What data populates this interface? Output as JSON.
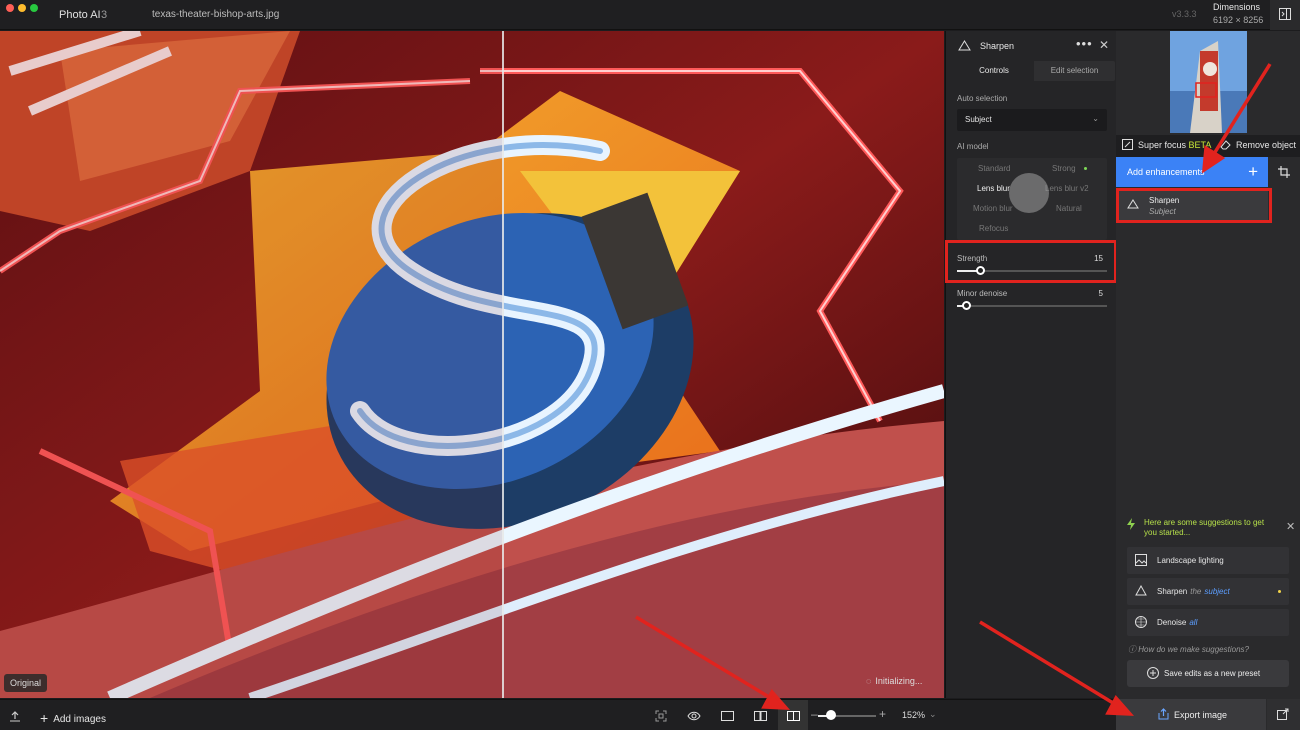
{
  "titlebar": {
    "app_name": "Photo AI",
    "app_version": "3",
    "file_name": "texas-theater-bishop-arts.jpg",
    "build": "v3.3.3",
    "dimensions_label": "Dimensions",
    "dimensions_value": "6192 × 8256"
  },
  "canvas": {
    "original_label": "Original",
    "status": "Initializing..."
  },
  "bottombar": {
    "add_images": "Add images",
    "zoom_level": "152%",
    "zoom_value": 0.25
  },
  "sharpen": {
    "title": "Sharpen",
    "tabs": [
      "Controls",
      "Edit selection"
    ],
    "auto_selection_label": "Auto selection",
    "auto_selection_value": "Subject",
    "ai_model_label": "AI model",
    "models": [
      "Standard",
      "Strong",
      "Lens blur",
      "Lens blur v2",
      "Motion blur",
      "Natural",
      "Refocus"
    ],
    "active_model": "Lens blur",
    "strength": {
      "label": "Strength",
      "value": "15",
      "level": 0.15
    },
    "minor_denoise": {
      "label": "Minor denoise",
      "value": "5",
      "level": 0.05
    }
  },
  "right_panel": {
    "super_focus": "Super focus",
    "beta": "BETA",
    "remove_object": "Remove object",
    "add_enhancements": "Add enhancements",
    "enhancement": {
      "name": "Sharpen",
      "target": "Subject"
    },
    "suggestions_heading": "Here are some suggestions to get you started...",
    "suggestions": [
      {
        "label": "Landscape lighting",
        "sub": ""
      },
      {
        "label": "Sharpen",
        "sub_muted": "the",
        "sub": "subject"
      },
      {
        "label": "Denoise",
        "sub": "all"
      }
    ],
    "how_text": "How do we make suggestions?",
    "save_preset": "Save edits as a new preset",
    "export": "Export image"
  },
  "colors": {
    "accent": "#3b82f6",
    "highlight": "#e1231e",
    "beta": "#c8e636"
  }
}
